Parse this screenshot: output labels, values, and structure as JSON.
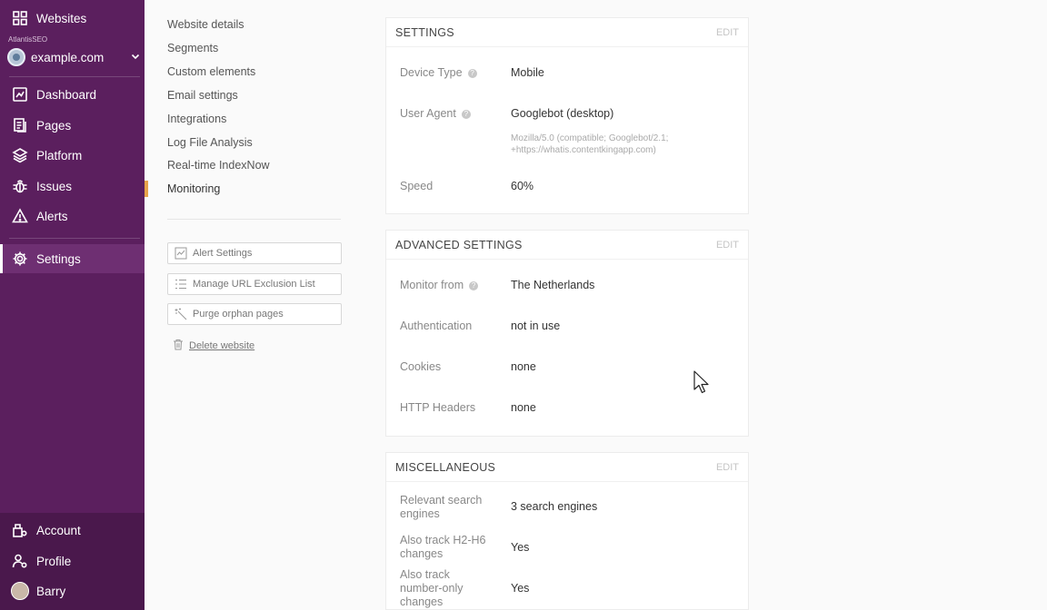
{
  "sidebar": {
    "top": {
      "label": "Websites",
      "icon": "grid-icon"
    },
    "org_name": "AtlantisSEO",
    "site": {
      "label": "example.com",
      "icon": "globe-icon"
    },
    "nav": [
      {
        "label": "Dashboard",
        "icon": "dashboard-icon"
      },
      {
        "label": "Pages",
        "icon": "pages-icon"
      },
      {
        "label": "Platform",
        "icon": "layers-icon"
      },
      {
        "label": "Issues",
        "icon": "bug-icon"
      },
      {
        "label": "Alerts",
        "icon": "warning-icon"
      },
      {
        "label": "Settings",
        "icon": "gear-icon",
        "active": true
      }
    ],
    "bottom": [
      {
        "label": "Account",
        "icon": "account-icon"
      },
      {
        "label": "Profile",
        "icon": "profile-icon"
      },
      {
        "label": "Barry",
        "icon": "avatar"
      }
    ]
  },
  "subnav": {
    "items": [
      "Website details",
      "Segments",
      "Custom elements",
      "Email settings",
      "Integrations",
      "Log File Analysis",
      "Real-time IndexNow",
      "Monitoring"
    ],
    "active": "Monitoring",
    "actions": [
      {
        "label": "Alert Settings",
        "icon": "chart-icon"
      },
      {
        "label": "Manage URL Exclusion List",
        "icon": "list-icon"
      },
      {
        "label": "Purge orphan pages",
        "icon": "wand-icon"
      }
    ],
    "delete_label": "Delete website"
  },
  "settings": {
    "title": "SETTINGS",
    "edit": "EDIT",
    "device_type_label": "Device Type",
    "device_type_value": "Mobile",
    "user_agent_label": "User Agent",
    "user_agent_value": "Googlebot (desktop)",
    "user_agent_string": "Mozilla/5.0 (compatible; Googlebot/2.1; +https://whatis.contentkingapp.com)",
    "speed_label": "Speed",
    "speed_value": "60%"
  },
  "advanced": {
    "title": "ADVANCED SETTINGS",
    "edit": "EDIT",
    "monitor_from_label": "Monitor from",
    "monitor_from_value": "The Netherlands",
    "authentication_label": "Authentication",
    "authentication_value": "not in use",
    "cookies_label": "Cookies",
    "cookies_value": "none",
    "http_headers_label": "HTTP Headers",
    "http_headers_value": "none"
  },
  "misc": {
    "title": "MISCELLANEOUS",
    "edit": "EDIT",
    "search_engines_label": "Relevant search engines",
    "search_engines_value": "3 search engines",
    "h2h6_label": "Also track H2-H6 changes",
    "h2h6_value": "Yes",
    "number_only_label": "Also track number-only changes",
    "number_only_value": "Yes"
  },
  "colors": {
    "sidebar": "#5b1f5e",
    "accent": "#e7a34b"
  }
}
